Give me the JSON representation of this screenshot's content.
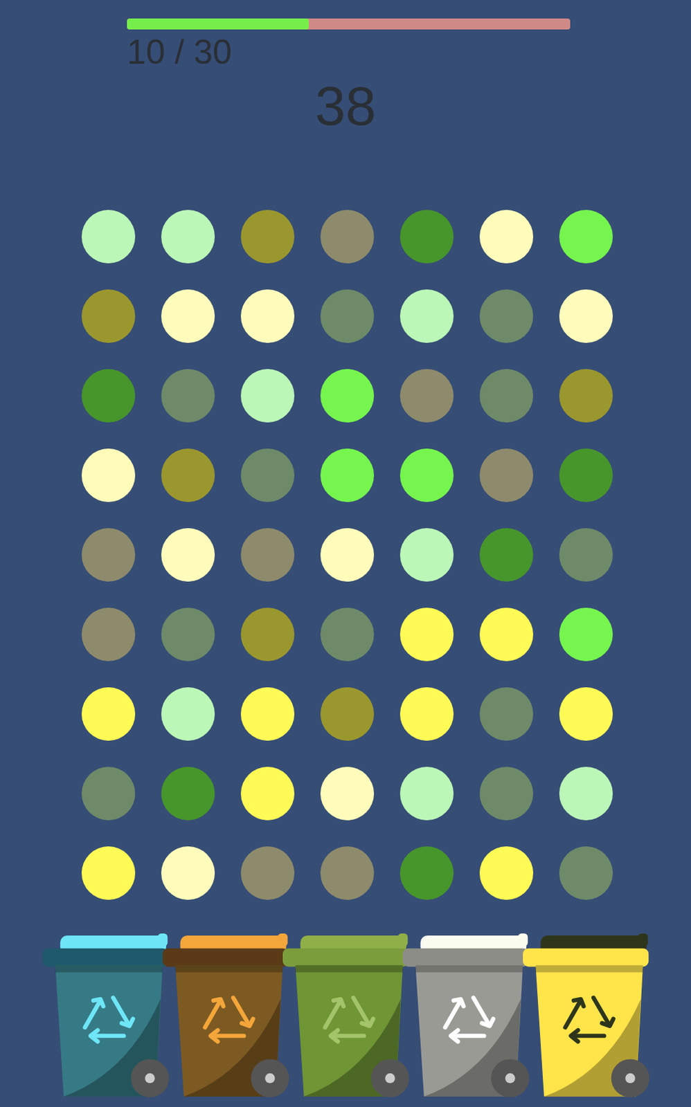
{
  "progress": {
    "level": 0.41,
    "reading": "10 / 30"
  },
  "score": "38",
  "grid": [
    [
      "#bbf7b7",
      "#bbf7b7",
      "#9b972f",
      "#8e8b6c",
      "#47962b",
      "#fffcbb",
      "#76f54e"
    ],
    [
      "#9b972f",
      "#fffcbb",
      "#fffcbb",
      "#6e8a69",
      "#bbf7b7",
      "#6e8a69",
      "#fffcbb"
    ],
    [
      "#47962b",
      "#6e8a69",
      "#bbf7b7",
      "#76f54e",
      "#8e8b6c",
      "#6e8a69",
      "#9b972f"
    ],
    [
      "#fffcbb",
      "#9b972f",
      "#6e8a69",
      "#76f54e",
      "#76f54e",
      "#8e8b6c",
      "#47962b"
    ],
    [
      "#8e8b6c",
      "#fffcbb",
      "#8e8b6c",
      "#fffcbb",
      "#bbf7b7",
      "#47962b",
      "#6e8a69"
    ],
    [
      "#8e8b6c",
      "#6e8a69",
      "#9b972f",
      "#6e8a69",
      "#fffa55",
      "#fffa55",
      "#76f54e"
    ],
    [
      "#fffa55",
      "#bbf7b7",
      "#fffa55",
      "#9b972f",
      "#fffa55",
      "#6e8a69",
      "#fffa55"
    ],
    [
      "#6e8a69",
      "#47962b",
      "#fffa55",
      "#fffcbb",
      "#bbf7b7",
      "#6e8a69",
      "#bbf7b7"
    ],
    [
      "#fffa55",
      "#fffcbb",
      "#8e8b6c",
      "#8e8b6c",
      "#47962b",
      "#fffa55",
      "#6e8a69"
    ]
  ],
  "bins": [
    {
      "color": "#367a85",
      "lid_color": "#6ee6f7",
      "rim_color": "#1f5a6c",
      "symbol_color": "#6ee6f7"
    },
    {
      "color": "#7d5a22",
      "lid_color": "#f4a63a",
      "rim_color": "#5a3a17",
      "symbol_color": "#f4a63a"
    },
    {
      "color": "#6f9535",
      "lid_color": "#8fb048",
      "rim_color": "#7b9d3c",
      "symbol_color": "#a4c46a"
    },
    {
      "color": "#9a9a95",
      "lid_color": "#fafcf0",
      "rim_color": "#8d8d88",
      "symbol_color": "#ffffff"
    },
    {
      "color": "#ffe44a",
      "lid_color": "#2d361a",
      "rim_color": "#ffe44a",
      "symbol_color": "#2d361a"
    }
  ]
}
